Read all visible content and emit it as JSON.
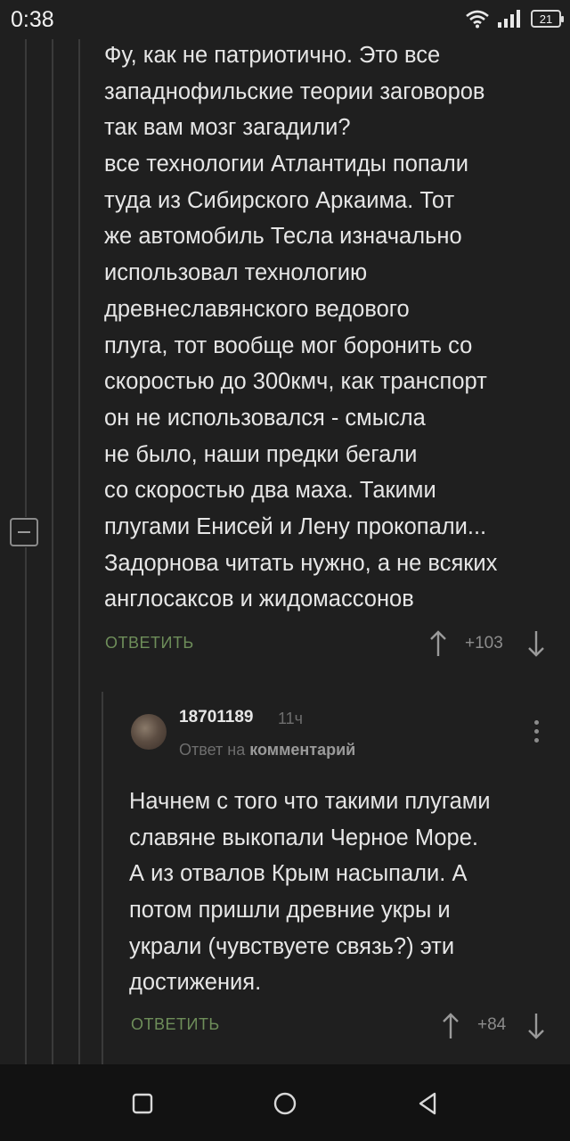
{
  "status": {
    "time": "0:38",
    "battery": "21"
  },
  "comment1": {
    "lines": [
      "Фу, как не патриотично. Это все",
      "западнофильские теории заговоров",
      "так вам мозг загадили?",
      "все технологии Атлантиды попали",
      "туда из Сибирского Аркаима. Тот",
      "же автомобиль Тесла изначально",
      "использовал технологию",
      "древнеславянского ведового",
      "плуга, тот вообще мог боронить со",
      "скоростью до 300кмч, как транспорт",
      "он не использовался - смысла",
      "не было, наши предки бегали",
      "со скоростью два маха. Такими",
      "плугами Енисей и Лену прокопали...",
      "Задорнова читать нужно, а не всяких",
      "англосаксов и жидомассонов"
    ],
    "reply_label": "ОТВЕТИТЬ",
    "rating": "+103"
  },
  "comment2": {
    "username": "18701189",
    "time": "11ч",
    "reply_to_prefix": "Ответ на",
    "reply_to_target": "комментарий",
    "lines": [
      "Начнем с того что такими плугами",
      "славяне выкопали Черное Море.",
      "А из отвалов Крым насыпали. А",
      "потом пришли древние укры и",
      "украли (чувствуете связь?) эти",
      "достижения."
    ],
    "reply_label": "ОТВЕТИТЬ",
    "rating": "+84"
  }
}
